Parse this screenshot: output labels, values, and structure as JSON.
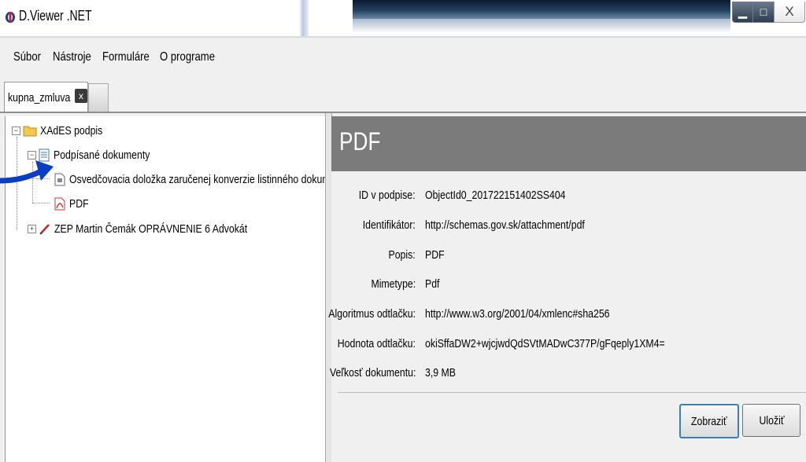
{
  "window": {
    "title": "D.Viewer .NET",
    "close_glyph": "X",
    "min_glyph": "▁",
    "max_glyph": "□"
  },
  "menu": [
    "Súbor",
    "Nástroje",
    "Formuláre",
    "O programe"
  ],
  "tab": {
    "label": "kupna_zmluva",
    "close_glyph": "x"
  },
  "tree": {
    "root": "XAdES podpis",
    "signed_docs": "Podpísané dokumenty",
    "doc1": "Osvedčovacia doložka zaručenej konverzie listinného dokumentu dc",
    "doc2": "PDF",
    "signer": "ZEP Martin Čemák OPRÁVNENIE 6 Advokát"
  },
  "detail": {
    "title": "PDF",
    "props": [
      {
        "label": "ID v podpise:",
        "value": "ObjectId0_201722151402SS404"
      },
      {
        "label": "Identifikátor:",
        "value": "http://schemas.gov.sk/attachment/pdf"
      },
      {
        "label": "Popis:",
        "value": "PDF"
      },
      {
        "label": "Mimetype:",
        "value": "Pdf"
      },
      {
        "label": "Algoritmus odtlačku:",
        "value": "http://www.w3.org/2001/04/xmlenc#sha256"
      },
      {
        "label": "Hodnota odtlačku:",
        "value": "okiSffaDW2+wjcjwdQdSVtMADwC377P/gFqeply1XM4="
      },
      {
        "label": "Veľkosť dokumentu:",
        "value": "3,9 MB"
      }
    ],
    "show_button": "Zobraziť",
    "save_button": "Uložiť"
  },
  "colors": {
    "header_bg": "#7b7b7b",
    "arrow": "#0a3fc4",
    "folder": "#f2c94c",
    "pdf": "#d0312d"
  }
}
